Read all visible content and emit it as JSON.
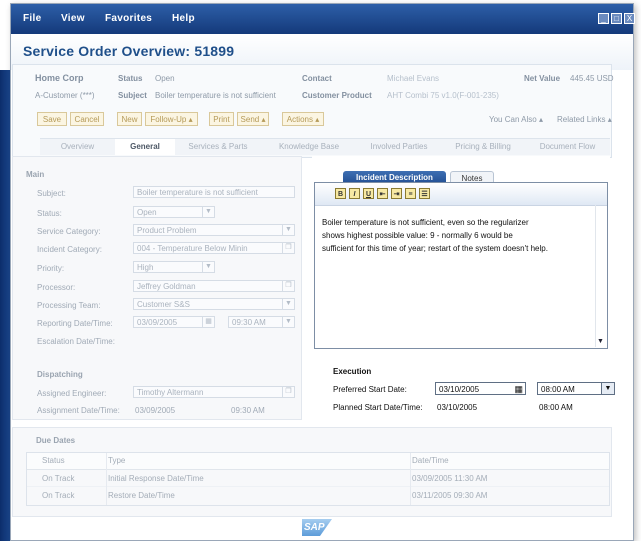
{
  "menu": {
    "file": "File",
    "view": "View",
    "favorites": "Favorites",
    "help": "Help"
  },
  "window_controls": {
    "minimize": "_",
    "maximize": "□",
    "close": "X"
  },
  "page_title": "Service Order Overview: 51899",
  "header": {
    "company": "Home Corp",
    "customer_type": "A-Customer (***)",
    "status_label": "Status",
    "status_value": "Open",
    "subject_label": "Subject",
    "subject_value": "Boiler temperature is not sufficient",
    "contact_label": "Contact",
    "contact_value": "Michael Evans",
    "customer_product_label": "Customer Product",
    "customer_product_value": "AHT Combi 75 v1.0(F-001-235)",
    "net_value_label": "Net Value",
    "net_value": "445.45 USD"
  },
  "toolbar": {
    "save": "Save",
    "cancel": "Cancel",
    "new": "New",
    "follow_up": "Follow-Up ▴",
    "print": "Print",
    "send": "Send ▴",
    "actions": "Actions ▴",
    "you_can_also": "You Can Also ▴",
    "related_links": "Related Links ▴"
  },
  "tabs": [
    "Overview",
    "General",
    "Services & Parts",
    "Knowledge Base",
    "Involved Parties",
    "Pricing & Billing",
    "Document Flow"
  ],
  "main": {
    "section": "Main",
    "subject_label": "Subject:",
    "subject_value": "Boiler temperature is not sufficient",
    "status_label": "Status:",
    "status_value": "Open",
    "service_category_label": "Service Category:",
    "service_category_value": "Product Problem",
    "incident_category_label": "Incident Category:",
    "incident_category_value": "004 - Temperature Below Minin",
    "priority_label": "Priority:",
    "priority_value": "High",
    "processor_label": "Processor:",
    "processor_value": "Jeffrey Goldman",
    "processing_team_label": "Processing Team:",
    "processing_team_value": "Customer S&S",
    "reporting_label": "Reporting Date/Time:",
    "reporting_date": "03/09/2005",
    "reporting_time": "09:30 AM",
    "escalation_label": "Escalation Date/Time:"
  },
  "dispatching": {
    "section": "Dispatching",
    "engineer_label": "Assigned Engineer:",
    "engineer_value": "Timothy Altermann",
    "assignment_label": "Assignment Date/Time:",
    "assignment_date": "03/09/2005",
    "assignment_time": "09:30 AM"
  },
  "note": {
    "tab_incident": "Incident Description",
    "tab_notes": "Notes",
    "format_buttons": [
      "B",
      "I",
      "U"
    ],
    "lines": [
      "Boiler temperature is not sufficient, even so the regularizer",
      "shows highest  possible value: 9 - normally 6 would be",
      "sufficient for this time of year; restart of the system doesn't help."
    ]
  },
  "execution": {
    "section": "Execution",
    "preferred_label": "Preferred Start Date:",
    "preferred_date": "03/10/2005",
    "preferred_time": "08:00 AM",
    "planned_label": "Planned Start Date/Time:",
    "planned_date": "03/10/2005",
    "planned_time": "08:00 AM"
  },
  "due_dates": {
    "section": "Due Dates",
    "columns": [
      "Status",
      "Type",
      "Date/Time"
    ],
    "rows": [
      [
        "On Track",
        "Initial Response Date/Time",
        "03/09/2005 11:30 AM"
      ],
      [
        "On Track",
        "Restore Date/Time",
        "03/11/2005 09:30 AM"
      ]
    ]
  },
  "logo": "SAP",
  "colors": {
    "menubar": "#1e4a8c",
    "title": "#1f4f8a",
    "accent_button": "#fbf5e2"
  }
}
